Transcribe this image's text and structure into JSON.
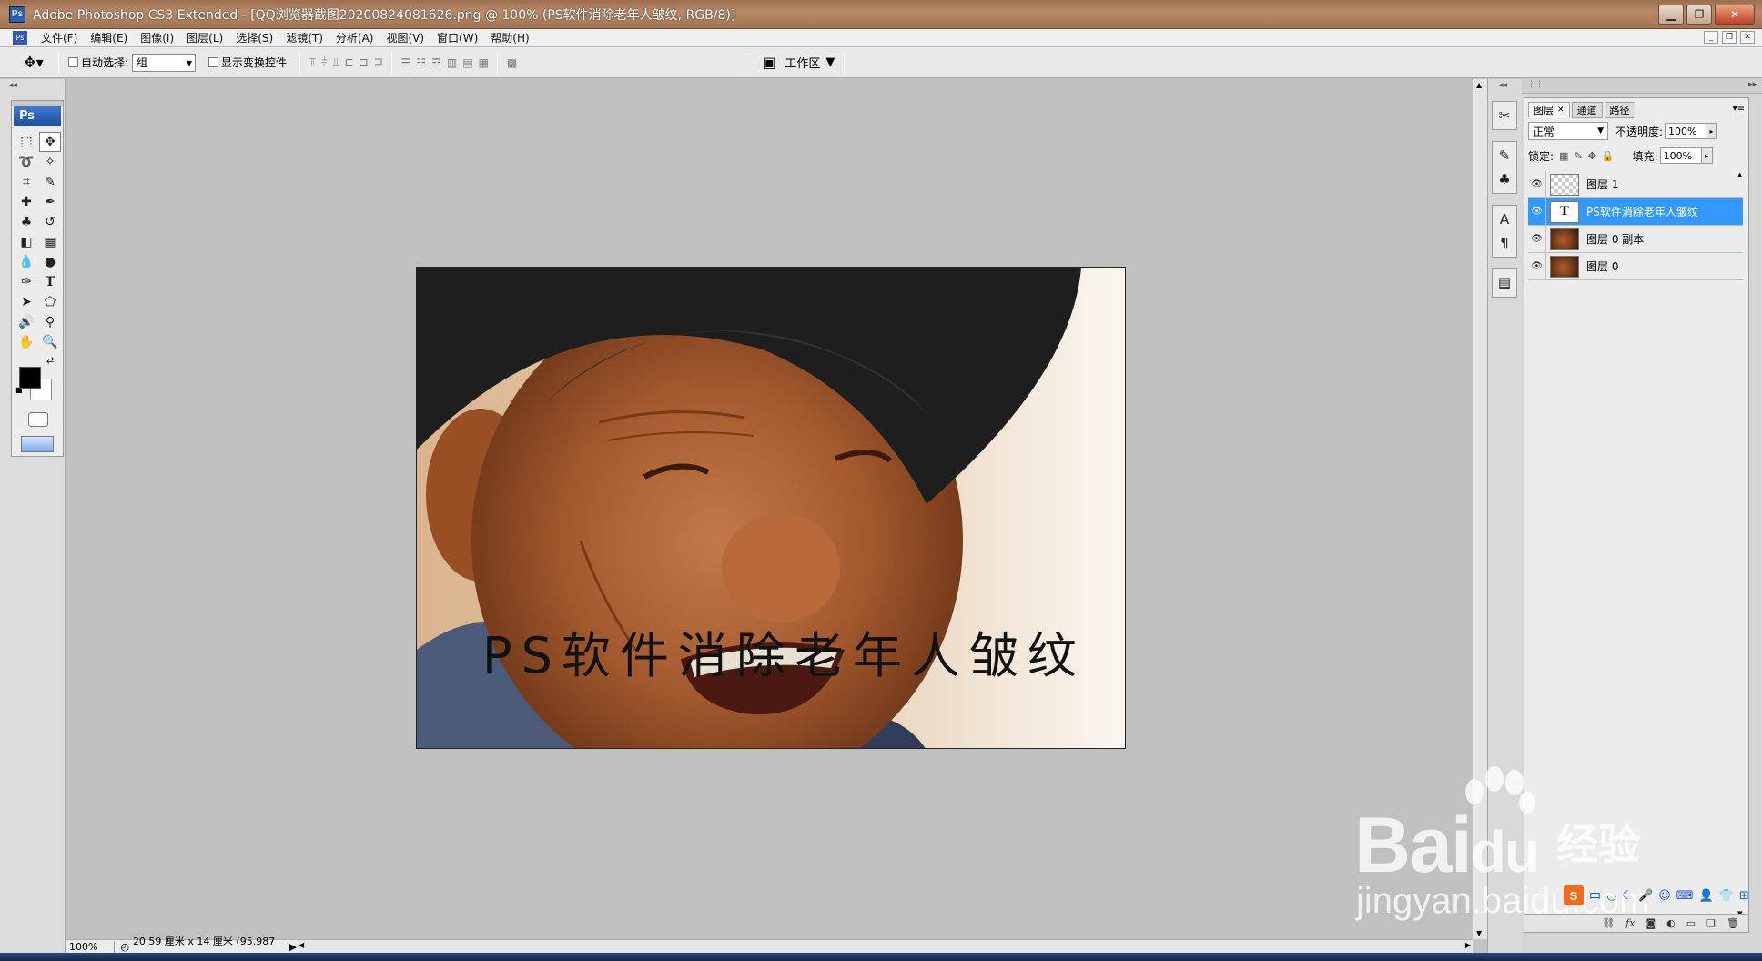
{
  "window": {
    "title": "Adobe Photoshop CS3 Extended - [QQ浏览器截图20200824081626.png @ 100% (PS软件消除老年人皱纹, RGB/8)]",
    "app_icon": "Ps"
  },
  "menu": {
    "items": [
      "文件(F)",
      "编辑(E)",
      "图像(I)",
      "图层(L)",
      "选择(S)",
      "滤镜(T)",
      "分析(A)",
      "视图(V)",
      "窗口(W)",
      "帮助(H)"
    ]
  },
  "options": {
    "auto_select_label": "自动选择:",
    "auto_select_value": "组",
    "show_transform_label": "显示变换控件",
    "workspace_label": "工作区"
  },
  "toolbox": {
    "logo": "Ps"
  },
  "canvas": {
    "overlay_text": "PS软件消除老年人皱纹"
  },
  "status": {
    "zoom": "100%",
    "doc_info": "20.59 厘米 x 14 厘米 (95.987 ..."
  },
  "layers_panel": {
    "tabs": [
      "图层",
      "通道",
      "路径"
    ],
    "blend_mode": "正常",
    "opacity_label": "不透明度:",
    "opacity_value": "100%",
    "lock_label": "锁定:",
    "fill_label": "填充:",
    "fill_value": "100%",
    "layers": [
      {
        "name": "图层 1",
        "thumb": "checker",
        "selected": false
      },
      {
        "name": "PS软件消除老年人皱纹",
        "thumb": "text",
        "thumb_glyph": "T",
        "selected": true
      },
      {
        "name": "图层 0 副本",
        "thumb": "photo",
        "selected": false
      },
      {
        "name": "图层 0",
        "thumb": "photo",
        "selected": false
      }
    ]
  },
  "watermark": {
    "brand": "Bai",
    "brand_suffix": "du",
    "cn": "经验",
    "url": "jingyan.baidu.com"
  },
  "ime": {
    "logo": "S",
    "mode": "中"
  },
  "colors": {
    "selection": "#3399ff",
    "titlebar": "#b88a68",
    "workspace_bg": "#c0c0c0"
  }
}
